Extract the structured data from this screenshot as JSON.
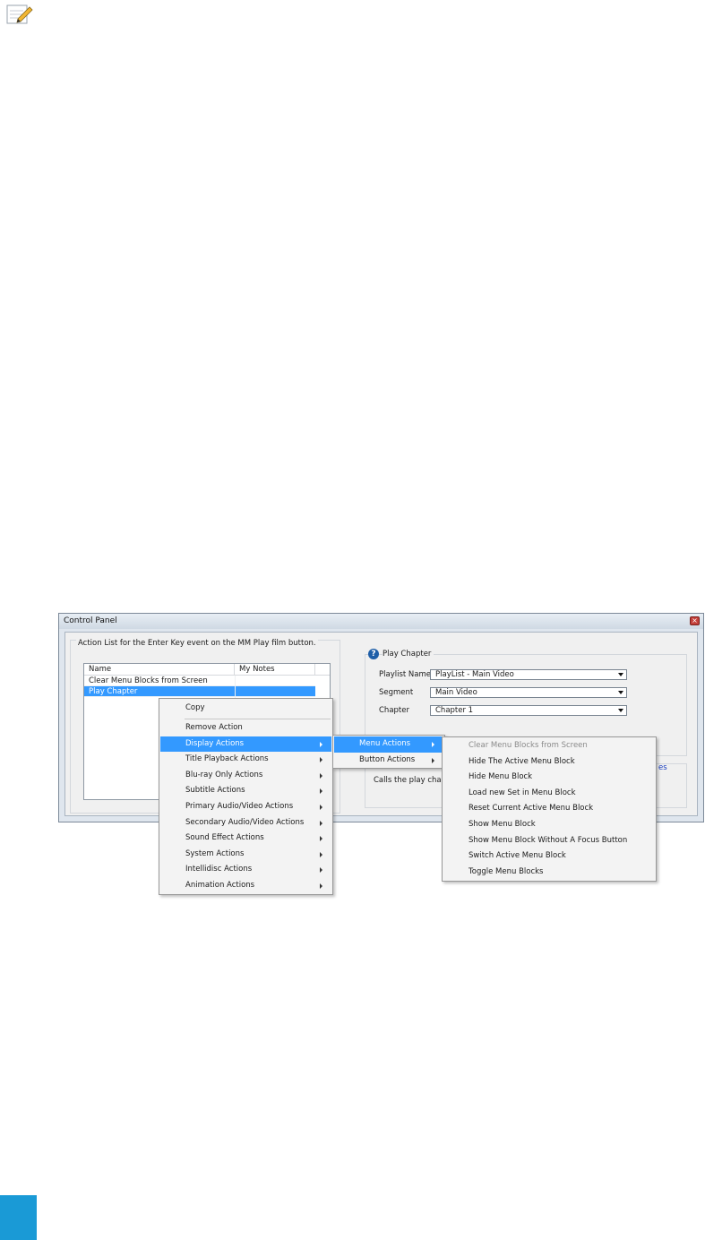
{
  "window": {
    "title": "Control Panel",
    "close_glyph": "×"
  },
  "action_list": {
    "label": "Action List for the Enter Key event on the MM Play film button.",
    "columns": [
      "Name",
      "My Notes"
    ],
    "rows": [
      "Clear Menu Blocks from Screen",
      "Play Chapter"
    ],
    "selected_row": "Play Chapter"
  },
  "play_chapter": {
    "title": "Play Chapter",
    "help_glyph": "?",
    "fields": [
      {
        "label": "Playlist Name",
        "value": "PlayList - Main Video"
      },
      {
        "label": "Segment",
        "value": "Main Video"
      },
      {
        "label": "Chapter",
        "value": "Chapter 1"
      }
    ],
    "description": "Calls the play chapte",
    "link_text": "es"
  },
  "context_menu": {
    "items": [
      "Copy",
      "Remove Action",
      "Display Actions",
      "Title Playback Actions",
      "Blu-ray Only Actions",
      "Subtitle Actions",
      "Primary Audio/Video Actions",
      "Secondary Audio/Video Actions",
      "Sound Effect Actions",
      "System Actions",
      "Intellidisc Actions",
      "Animation Actions"
    ],
    "highlighted": "Display Actions"
  },
  "display_submenu": {
    "items": [
      "Menu Actions",
      "Button Actions"
    ],
    "highlighted": "Menu Actions"
  },
  "menu_actions_submenu": {
    "items": [
      "Clear Menu Blocks from Screen",
      "Hide The Active Menu Block",
      "Hide Menu Block",
      "Load new Set in Menu Block",
      "Reset Current Active Menu Block",
      "Show Menu Block",
      "Show Menu Block Without A Focus Button",
      "Switch Active Menu Block",
      "Toggle Menu Blocks"
    ],
    "disabled": "Clear Menu Blocks from Screen"
  },
  "icons": [
    "note-pencil-icon",
    "help-icon",
    "close-icon",
    "dropdown-arrow-icon",
    "submenu-arrow-icon"
  ],
  "colors": {
    "highlight": "#3399ff",
    "accent_square": "#1a9ad6",
    "close": "#c4403a",
    "link": "#1b3fc1"
  }
}
